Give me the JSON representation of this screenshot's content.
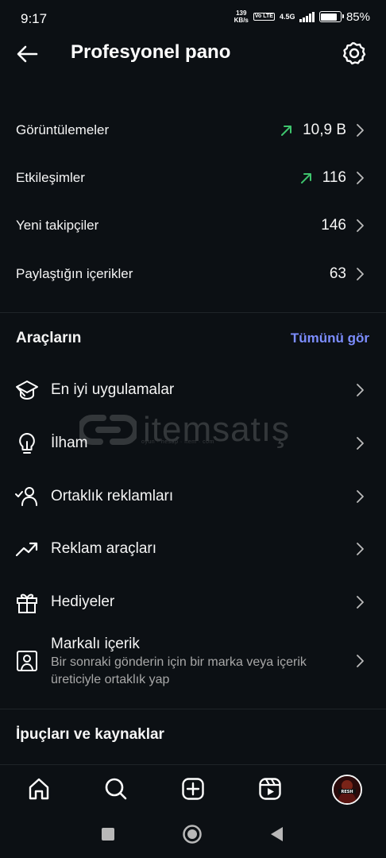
{
  "status_bar": {
    "time": "9:17",
    "speed_value": "139",
    "speed_unit": "KB/s",
    "volte": "Vo LTE",
    "network": "4.5G",
    "battery": "85%",
    "battery_level": 0.85
  },
  "header": {
    "title": "Profesyonel pano",
    "back_icon": "arrow-left-icon",
    "settings_icon": "gear-icon"
  },
  "stats": [
    {
      "label": "Görüntülemeler",
      "value": "10,9 B",
      "trend": "up"
    },
    {
      "label": "Etkileşimler",
      "value": "116",
      "trend": "up"
    },
    {
      "label": "Yeni takipçiler",
      "value": "146",
      "trend": ""
    },
    {
      "label": "Paylaştığın içerikler",
      "value": "63",
      "trend": ""
    }
  ],
  "tools": {
    "title": "Araçların",
    "see_all": "Tümünü gör",
    "items": [
      {
        "label": "En iyi uygulamalar",
        "icon": "graduation-cap-icon"
      },
      {
        "label": "İlham",
        "icon": "lightbulb-icon"
      },
      {
        "label": "Ortaklık reklamları",
        "icon": "person-check-icon"
      },
      {
        "label": "Reklam araçları",
        "icon": "trending-up-icon"
      },
      {
        "label": "Hediyeler",
        "icon": "gift-icon"
      },
      {
        "label": "Markalı içerik",
        "sublabel": "Bir sonraki gönderin için bir marka veya içerik üreticiyle ortaklık yap",
        "icon": "branded-content-icon"
      }
    ]
  },
  "tips": {
    "title": "İpuçları ve kaynaklar"
  },
  "watermark": {
    "text": "itemsatış",
    "sub": "oyun · hesap · item · com"
  },
  "avatar_text": "RESH",
  "colors": {
    "background": "#0c1014",
    "accent_link": "#7c8dff",
    "trend_up": "#3ec46d",
    "secondary_text": "#a8a8a8"
  }
}
